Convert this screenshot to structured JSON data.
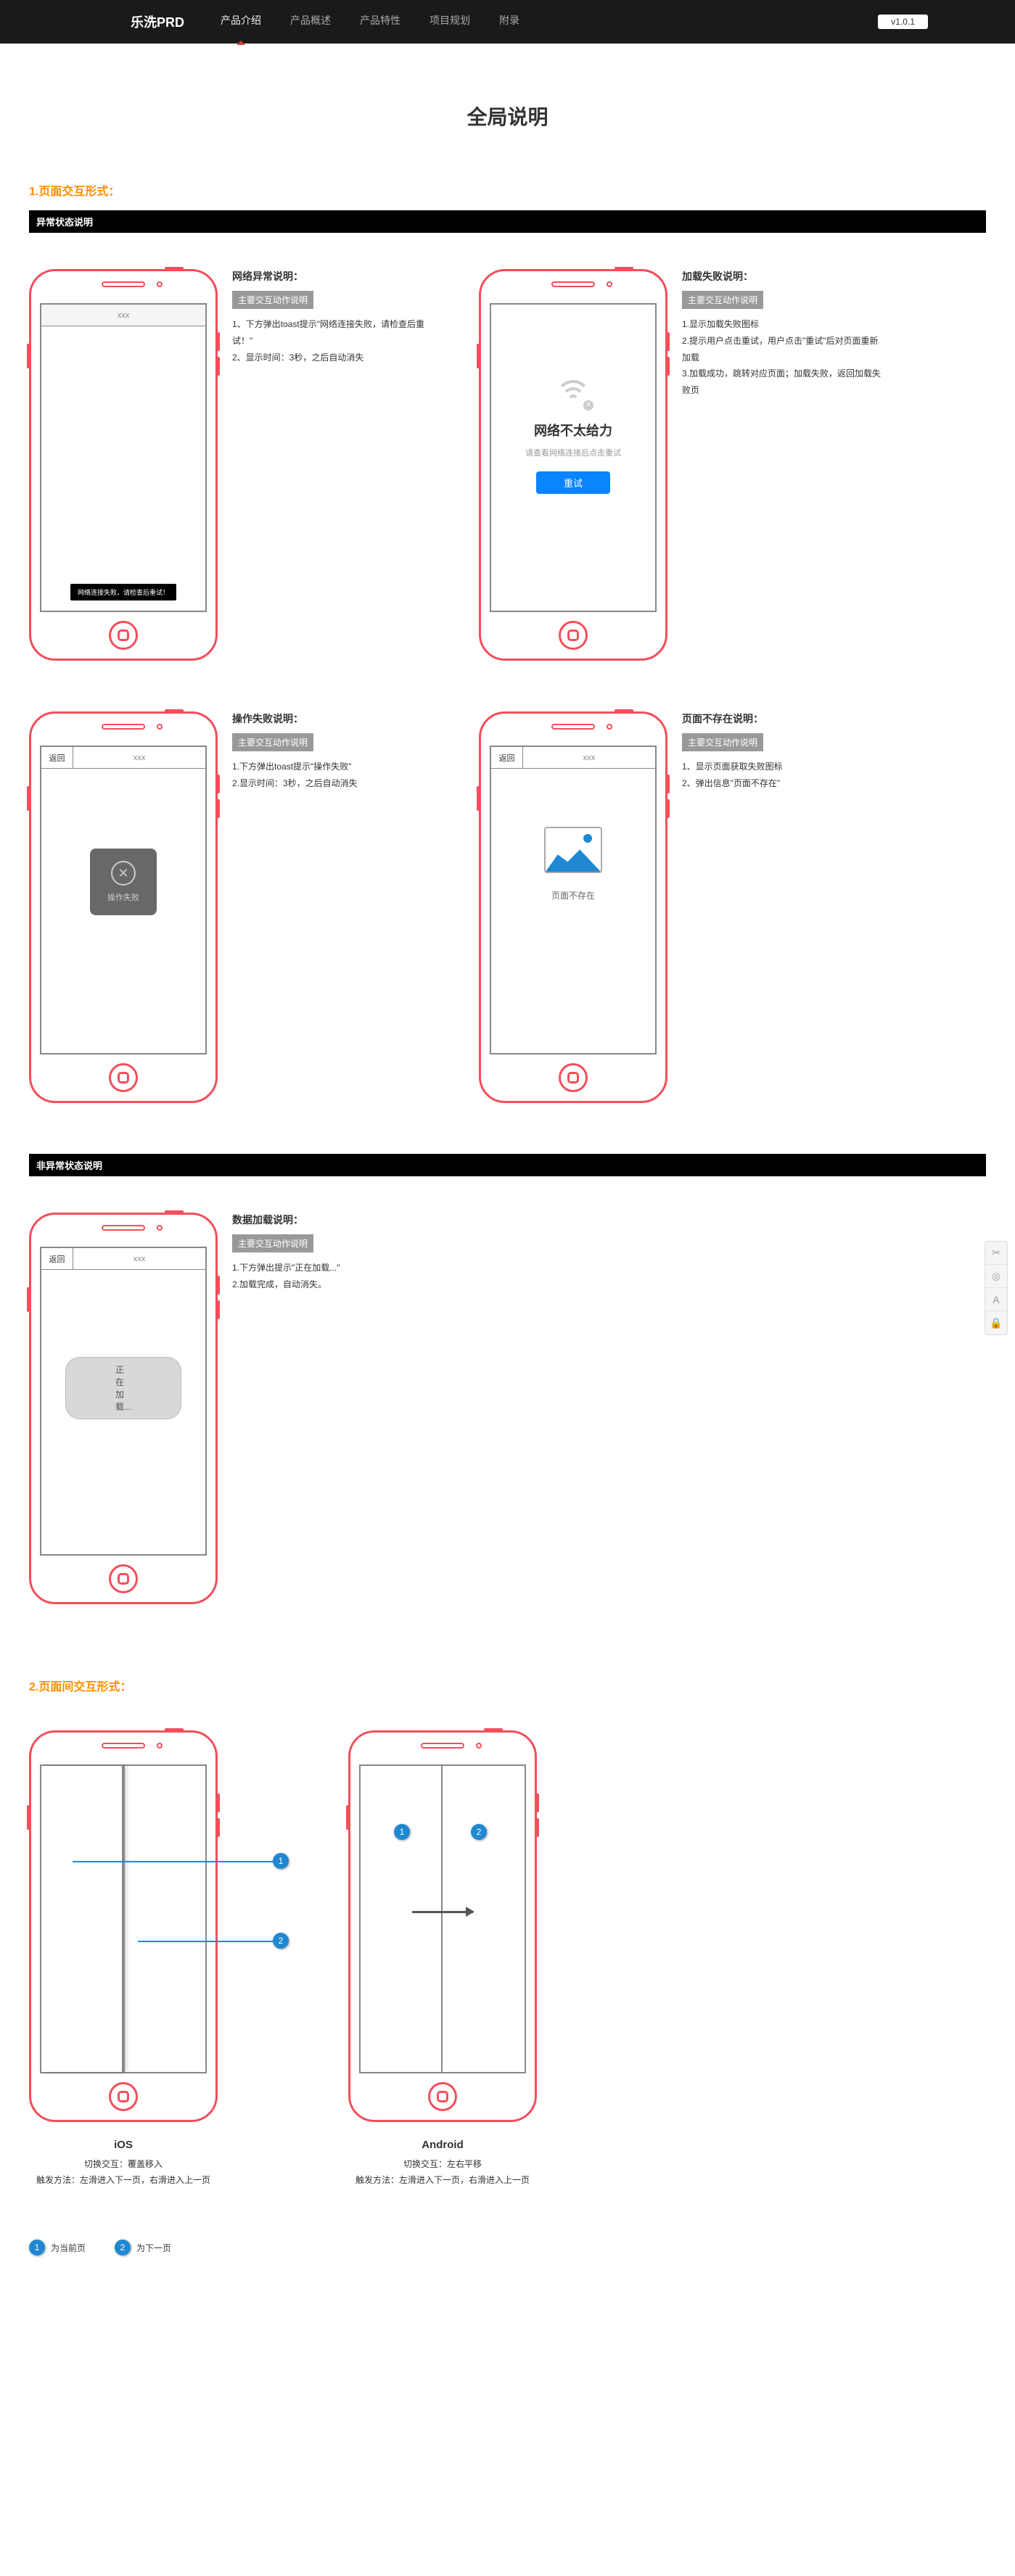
{
  "header": {
    "brand": "乐洗PRD",
    "nav": [
      "产品介绍",
      "产品概述",
      "产品特性",
      "项目规划",
      "附录"
    ],
    "active_index": 0,
    "version": "v1.0.1"
  },
  "title": "全局说明",
  "section1": {
    "heading": "1.页面交互形式：",
    "bar1": "异常状态说明",
    "network": {
      "title": "网络异常说明：",
      "sub": "主要交互动作说明",
      "body": "1、下方弹出toast提示\"网络连接失败，请检查后重试！\"\n2、显示时间：3秒，之后自动消失",
      "phone_title": "xxx",
      "toast": "网络连接失败，请检查后重试！"
    },
    "loadfail": {
      "title": "加载失败说明：",
      "sub": "主要交互动作说明",
      "body": "1.显示加载失败图标\n2.提示用户点击重试，用户点击\"重试\"后对页面重新加载\n3.加载成功，跳转对应页面；加载失败，返回加载失败页",
      "wifi_title": "网络不太给力",
      "wifi_sub": "请查看网络连接后点击重试",
      "retry": "重试"
    },
    "opfail": {
      "title": "操作失败说明：",
      "sub": "主要交互动作说明",
      "body": "1.下方弹出toast提示\"操作失败\"\n2.显示时间：3秒，之后自动消失",
      "back": "返回",
      "ptitle": "xxx",
      "toast": "操作失败"
    },
    "notfound": {
      "title": "页面不存在说明：",
      "sub": "主要交互动作说明",
      "body": "1、显示页面获取失败图标\n2、弹出信息\"页面不存在\"",
      "back": "返回",
      "ptitle": "xxx",
      "msg": "页面不存在"
    },
    "bar2": "非异常状态说明",
    "loading": {
      "title": "数据加载说明：",
      "sub": "主要交互动作说明",
      "body": "1.下方弹出提示\"正在加载...\"\n2.加载完成，自动消失。",
      "back": "返回",
      "ptitle": "xxx",
      "pill": "正在加载..."
    }
  },
  "section2": {
    "heading": "2.页面间交互形式：",
    "ios": {
      "title": "iOS",
      "line1": "切换交互：覆盖移入",
      "line2": "触发方法：左滑进入下一页，右滑进入上一页"
    },
    "android": {
      "title": "Android",
      "line1": "切换交互：左右平移",
      "line2": "触发方法：左滑进入下一页，右滑进入上一页"
    },
    "legend": {
      "n1": "1",
      "t1": "为当前页",
      "n2": "2",
      "t2": "为下一页"
    }
  }
}
